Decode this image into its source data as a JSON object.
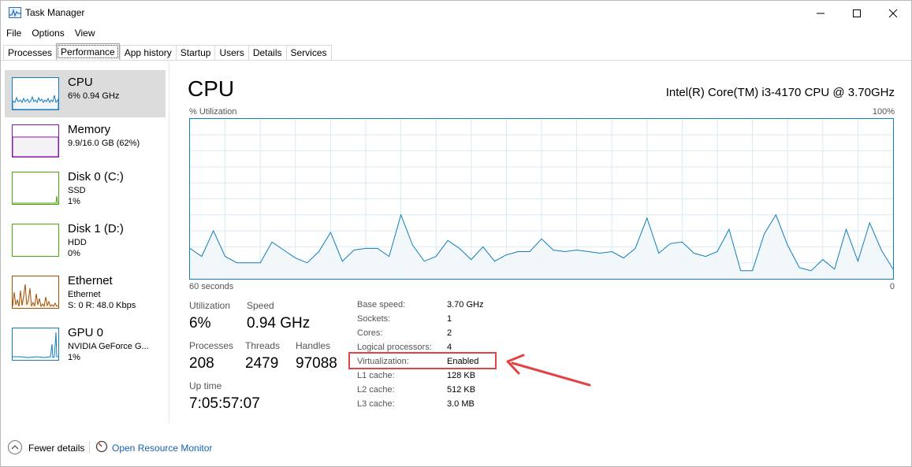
{
  "window": {
    "title": "Task Manager"
  },
  "menu": [
    "File",
    "Options",
    "View"
  ],
  "tabs": [
    "Processes",
    "Performance",
    "App history",
    "Startup",
    "Users",
    "Details",
    "Services"
  ],
  "active_tab": "Performance",
  "resources": [
    {
      "name": "CPU",
      "lines": [
        "6%  0.94 GHz"
      ],
      "color": "#117dbb",
      "selected": true
    },
    {
      "name": "Memory",
      "lines": [
        "9.9/16.0 GB (62%)"
      ],
      "color": "#8b12ae",
      "selected": false
    },
    {
      "name": "Disk 0 (C:)",
      "lines": [
        "SSD",
        "1%"
      ],
      "color": "#4da60c",
      "selected": false
    },
    {
      "name": "Disk 1 (D:)",
      "lines": [
        "HDD",
        "0%"
      ],
      "color": "#4da60c",
      "selected": false
    },
    {
      "name": "Ethernet",
      "lines": [
        "Ethernet",
        "S: 0  R: 48.0 Kbps"
      ],
      "color": "#a74f01",
      "selected": false
    },
    {
      "name": "GPU 0",
      "lines": [
        "NVIDIA GeForce G...",
        "1%"
      ],
      "color": "#117dbb",
      "selected": false
    }
  ],
  "cpu": {
    "title": "CPU",
    "model": "Intel(R) Core(TM) i3-4170 CPU @ 3.70GHz",
    "axis_label": "% Utilization",
    "axis_max": "100%",
    "axis_time": "60 seconds",
    "axis_min": "0"
  },
  "stats": {
    "utilization": {
      "label": "Utilization",
      "value": "6%"
    },
    "speed": {
      "label": "Speed",
      "value": "0.94 GHz"
    },
    "processes": {
      "label": "Processes",
      "value": "208"
    },
    "threads": {
      "label": "Threads",
      "value": "2479"
    },
    "handles": {
      "label": "Handles",
      "value": "97088"
    },
    "uptime": {
      "label": "Up time",
      "value": "7:05:57:07"
    }
  },
  "specs": [
    {
      "label": "Base speed:",
      "value": "3.70 GHz"
    },
    {
      "label": "Sockets:",
      "value": "1"
    },
    {
      "label": "Cores:",
      "value": "2"
    },
    {
      "label": "Logical processors:",
      "value": "4"
    },
    {
      "label": "Virtualization:",
      "value": "Enabled"
    },
    {
      "label": "L1 cache:",
      "value": "128 KB"
    },
    {
      "label": "L2 cache:",
      "value": "512 KB"
    },
    {
      "label": "L3 cache:",
      "value": "3.0 MB"
    }
  ],
  "highlighted_spec": "Virtualization:",
  "annotation_color": "#e04545",
  "footer": {
    "fewer_details": "Fewer details",
    "resource_monitor": "Open Resource Monitor"
  },
  "chart_data": {
    "type": "area",
    "y_range": [
      0,
      100
    ],
    "x_range_seconds": 60,
    "series": [
      {
        "values": [
          19,
          14,
          30,
          14,
          10,
          10,
          10,
          23,
          18,
          13,
          10,
          17,
          29,
          11,
          18,
          19,
          19,
          14,
          40,
          21,
          11,
          14,
          24,
          19,
          12,
          20,
          11,
          15,
          17,
          17,
          25,
          18,
          17,
          18,
          17,
          16,
          17,
          13,
          19,
          38,
          16,
          22,
          23,
          16,
          14,
          17,
          31,
          5,
          5,
          28,
          40,
          21,
          7,
          5,
          12,
          6,
          31,
          11,
          35,
          18,
          6
        ]
      }
    ]
  }
}
